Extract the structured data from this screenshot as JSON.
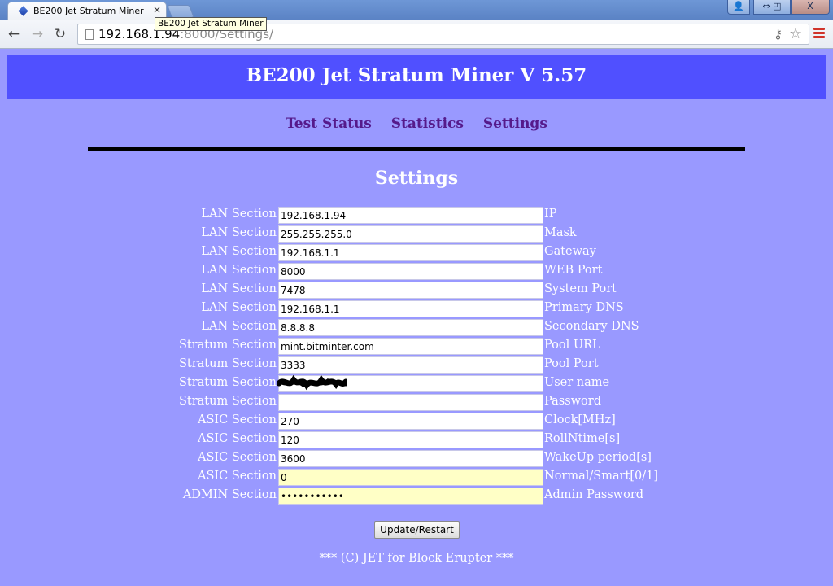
{
  "browser": {
    "tab_title": "BE200 Jet Stratum Miner",
    "tooltip": "BE200 Jet Stratum Miner",
    "url_host": "192.168.1.94",
    "url_rest": ":8000/Settings/",
    "close_glyph": "×",
    "back_glyph": "←",
    "forward_glyph": "→",
    "reload_glyph": "↻",
    "key_glyph": "⚷",
    "star_glyph": "☆",
    "user_glyph": "👤",
    "restore_glyph": "⇔ ◰",
    "winclose_glyph": "X"
  },
  "header": {
    "title": "BE200 Jet Stratum Miner V 5.57"
  },
  "nav": {
    "links": [
      "Test Status",
      "Statistics",
      "Settings"
    ]
  },
  "section_title": "Settings",
  "rows": [
    {
      "section": "LAN Section",
      "value": "192.168.1.94",
      "desc": "IP"
    },
    {
      "section": "LAN Section",
      "value": "255.255.255.0",
      "desc": "Mask"
    },
    {
      "section": "LAN Section",
      "value": "192.168.1.1",
      "desc": "Gateway"
    },
    {
      "section": "LAN Section",
      "value": "8000",
      "desc": "WEB Port"
    },
    {
      "section": "LAN Section",
      "value": "7478",
      "desc": "System Port"
    },
    {
      "section": "LAN Section",
      "value": "192.168.1.1",
      "desc": "Primary DNS"
    },
    {
      "section": "LAN Section",
      "value": "8.8.8.8",
      "desc": "Secondary DNS"
    },
    {
      "section": "Stratum Section",
      "value": "mint.bitminter.com",
      "desc": "Pool URL"
    },
    {
      "section": "Stratum Section",
      "value": "3333",
      "desc": "Pool Port"
    },
    {
      "section": "Stratum Section",
      "value": "",
      "desc": "User name"
    },
    {
      "section": "Stratum Section",
      "value": "",
      "desc": "Password"
    },
    {
      "section": "ASIC Section",
      "value": "270",
      "desc": "Clock[MHz]"
    },
    {
      "section": "ASIC Section",
      "value": "120",
      "desc": "RollNtime[s]"
    },
    {
      "section": "ASIC Section",
      "value": "3600",
      "desc": "WakeUp period[s]"
    },
    {
      "section": "ASIC Section",
      "value": "0",
      "desc": "Normal/Smart[0/1]"
    },
    {
      "section": "ADMIN Section",
      "value": "•••••••••••",
      "desc": "Admin Password"
    }
  ],
  "button_label": "Update/Restart",
  "footer": "*** (C) JET for Block Erupter ***",
  "colors": {
    "page_bg": "#9999ff",
    "header_bg": "#5050ff",
    "link": "#551a8b",
    "highlight_field": "#ffffc6"
  }
}
